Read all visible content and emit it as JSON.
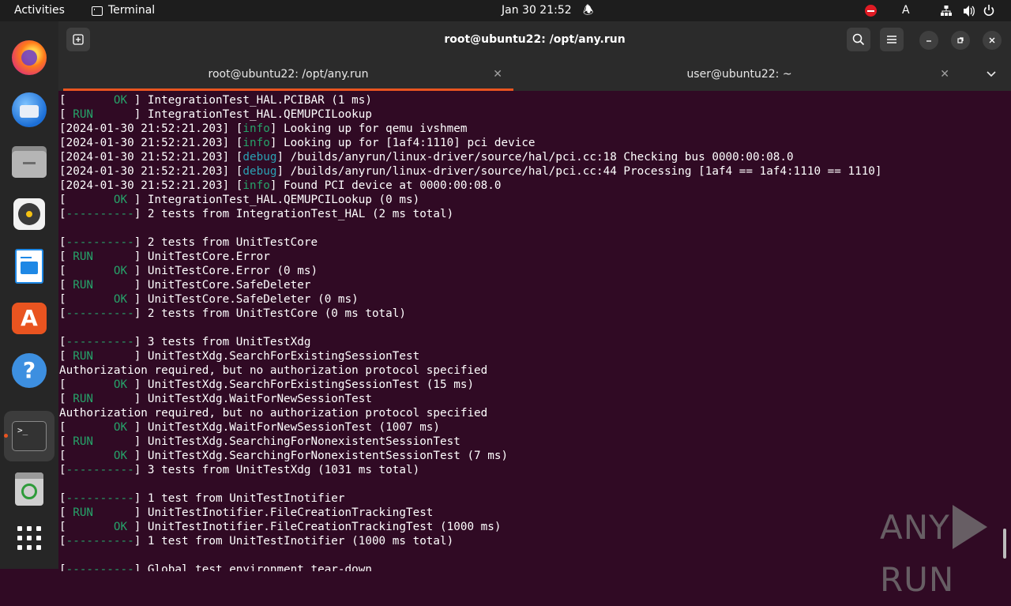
{
  "topbar": {
    "activities": "Activities",
    "app_name": "Terminal",
    "clock": "Jan 30  21:52",
    "keyboard_layout": "A"
  },
  "dock": {
    "items": [
      "firefox-icon",
      "thunderbird-icon",
      "files-icon",
      "rhythmbox-icon",
      "writer-icon",
      "app-center-icon",
      "help-icon",
      "terminal-icon",
      "trash-icon",
      "show-apps-icon"
    ]
  },
  "window": {
    "title": "root@ubuntu22: /opt/any.run",
    "tabs": [
      {
        "label": "root@ubuntu22: /opt/any.run",
        "active": true
      },
      {
        "label": "user@ubuntu22: ~",
        "active": false
      }
    ]
  },
  "colors": {
    "accent": "#e95420",
    "terminal_bg": "#300a24",
    "ok_green": "#26a269",
    "info_cyan": "#2aa1b3"
  },
  "terminal": {
    "lines": [
      [
        {
          "t": "["
        },
        {
          "t": "       OK ",
          "c": "g"
        },
        {
          "t": "] IntegrationTest_HAL.PCIBAR (1 ms)"
        }
      ],
      [
        {
          "t": "["
        },
        {
          "t": " RUN      ",
          "c": "g"
        },
        {
          "t": "] IntegrationTest_HAL.QEMUPCILookup"
        }
      ],
      [
        {
          "t": "[2024-01-30 21:52:21.203] ["
        },
        {
          "t": "info",
          "c": "g"
        },
        {
          "t": "] Looking up for qemu ivshmem"
        }
      ],
      [
        {
          "t": "[2024-01-30 21:52:21.203] ["
        },
        {
          "t": "info",
          "c": "g"
        },
        {
          "t": "] Looking up for [1af4:1110] pci device"
        }
      ],
      [
        {
          "t": "[2024-01-30 21:52:21.203] ["
        },
        {
          "t": "debug",
          "c": "c"
        },
        {
          "t": "] /builds/anyrun/linux-driver/source/hal/pci.cc:18 Checking bus 0000:00:08.0"
        }
      ],
      [
        {
          "t": "[2024-01-30 21:52:21.203] ["
        },
        {
          "t": "debug",
          "c": "c"
        },
        {
          "t": "] /builds/anyrun/linux-driver/source/hal/pci.cc:44 Processing [1af4 == 1af4:1110 == 1110]"
        }
      ],
      [
        {
          "t": "[2024-01-30 21:52:21.203] ["
        },
        {
          "t": "info",
          "c": "g"
        },
        {
          "t": "] Found PCI device at 0000:00:08.0"
        }
      ],
      [
        {
          "t": "["
        },
        {
          "t": "       OK ",
          "c": "g"
        },
        {
          "t": "] IntegrationTest_HAL.QEMUPCILookup (0 ms)"
        }
      ],
      [
        {
          "t": "["
        },
        {
          "t": "----------",
          "c": "g"
        },
        {
          "t": "] 2 tests from IntegrationTest_HAL (2 ms total)"
        }
      ],
      [
        {
          "t": ""
        }
      ],
      [
        {
          "t": "["
        },
        {
          "t": "----------",
          "c": "g"
        },
        {
          "t": "] 2 tests from UnitTestCore"
        }
      ],
      [
        {
          "t": "["
        },
        {
          "t": " RUN      ",
          "c": "g"
        },
        {
          "t": "] UnitTestCore.Error"
        }
      ],
      [
        {
          "t": "["
        },
        {
          "t": "       OK ",
          "c": "g"
        },
        {
          "t": "] UnitTestCore.Error (0 ms)"
        }
      ],
      [
        {
          "t": "["
        },
        {
          "t": " RUN      ",
          "c": "g"
        },
        {
          "t": "] UnitTestCore.SafeDeleter"
        }
      ],
      [
        {
          "t": "["
        },
        {
          "t": "       OK ",
          "c": "g"
        },
        {
          "t": "] UnitTestCore.SafeDeleter (0 ms)"
        }
      ],
      [
        {
          "t": "["
        },
        {
          "t": "----------",
          "c": "g"
        },
        {
          "t": "] 2 tests from UnitTestCore (0 ms total)"
        }
      ],
      [
        {
          "t": ""
        }
      ],
      [
        {
          "t": "["
        },
        {
          "t": "----------",
          "c": "g"
        },
        {
          "t": "] 3 tests from UnitTestXdg"
        }
      ],
      [
        {
          "t": "["
        },
        {
          "t": " RUN      ",
          "c": "g"
        },
        {
          "t": "] UnitTestXdg.SearchForExistingSessionTest"
        }
      ],
      [
        {
          "t": "Authorization required, but no authorization protocol specified"
        }
      ],
      [
        {
          "t": "["
        },
        {
          "t": "       OK ",
          "c": "g"
        },
        {
          "t": "] UnitTestXdg.SearchForExistingSessionTest (15 ms)"
        }
      ],
      [
        {
          "t": "["
        },
        {
          "t": " RUN      ",
          "c": "g"
        },
        {
          "t": "] UnitTestXdg.WaitForNewSessionTest"
        }
      ],
      [
        {
          "t": "Authorization required, but no authorization protocol specified"
        }
      ],
      [
        {
          "t": "["
        },
        {
          "t": "       OK ",
          "c": "g"
        },
        {
          "t": "] UnitTestXdg.WaitForNewSessionTest (1007 ms)"
        }
      ],
      [
        {
          "t": "["
        },
        {
          "t": " RUN      ",
          "c": "g"
        },
        {
          "t": "] UnitTestXdg.SearchingForNonexistentSessionTest"
        }
      ],
      [
        {
          "t": "["
        },
        {
          "t": "       OK ",
          "c": "g"
        },
        {
          "t": "] UnitTestXdg.SearchingForNonexistentSessionTest (7 ms)"
        }
      ],
      [
        {
          "t": "["
        },
        {
          "t": "----------",
          "c": "g"
        },
        {
          "t": "] 3 tests from UnitTestXdg (1031 ms total)"
        }
      ],
      [
        {
          "t": ""
        }
      ],
      [
        {
          "t": "["
        },
        {
          "t": "----------",
          "c": "g"
        },
        {
          "t": "] 1 test from UnitTestInotifier"
        }
      ],
      [
        {
          "t": "["
        },
        {
          "t": " RUN      ",
          "c": "g"
        },
        {
          "t": "] UnitTestInotifier.FileCreationTrackingTest"
        }
      ],
      [
        {
          "t": "["
        },
        {
          "t": "       OK ",
          "c": "g"
        },
        {
          "t": "] UnitTestInotifier.FileCreationTrackingTest (1000 ms)"
        }
      ],
      [
        {
          "t": "["
        },
        {
          "t": "----------",
          "c": "g"
        },
        {
          "t": "] 1 test from UnitTestInotifier (1000 ms total)"
        }
      ],
      [
        {
          "t": ""
        }
      ],
      [
        {
          "t": "["
        },
        {
          "t": "----------",
          "c": "g"
        },
        {
          "t": "] Global test environment tear-down"
        }
      ]
    ]
  },
  "watermark": {
    "left": "ANY",
    "right": "RUN"
  }
}
